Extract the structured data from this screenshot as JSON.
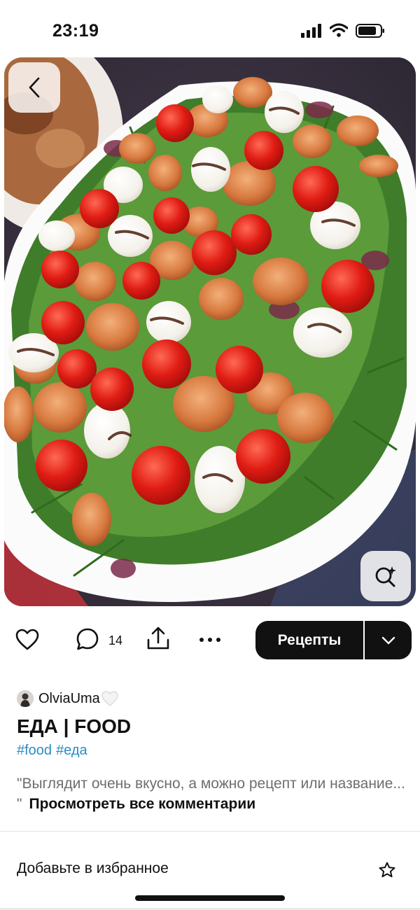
{
  "status_bar": {
    "time": "23:19"
  },
  "pin": {
    "back_icon": "chevron-left-icon",
    "visual_search_icon": "visual-search-icon"
  },
  "actions": {
    "like_icon": "heart-outline-icon",
    "comment_icon": "comment-bubble-icon",
    "comment_count": "14",
    "share_icon": "share-icon",
    "more_icon": "more-horizontal-icon",
    "recipes_label": "Рецепты",
    "recipes_dropdown_icon": "chevron-down-icon"
  },
  "author": {
    "name": "OlviaUma",
    "emoji": "🤍"
  },
  "board": {
    "title": "ЕДА | FOOD",
    "tags": [
      "#food",
      "#еда"
    ]
  },
  "comments": {
    "preview": "\"Выглядит очень вкусно, а можно рецепт или название... \"",
    "view_all": "Просмотреть все комментарии"
  },
  "favorites": {
    "label": "Добавьте в избранное",
    "icon": "star-outline-icon"
  },
  "colors": {
    "accent_dark": "#111111",
    "hashtag": "#2c8cc2",
    "muted_text": "#6e6e6e"
  }
}
